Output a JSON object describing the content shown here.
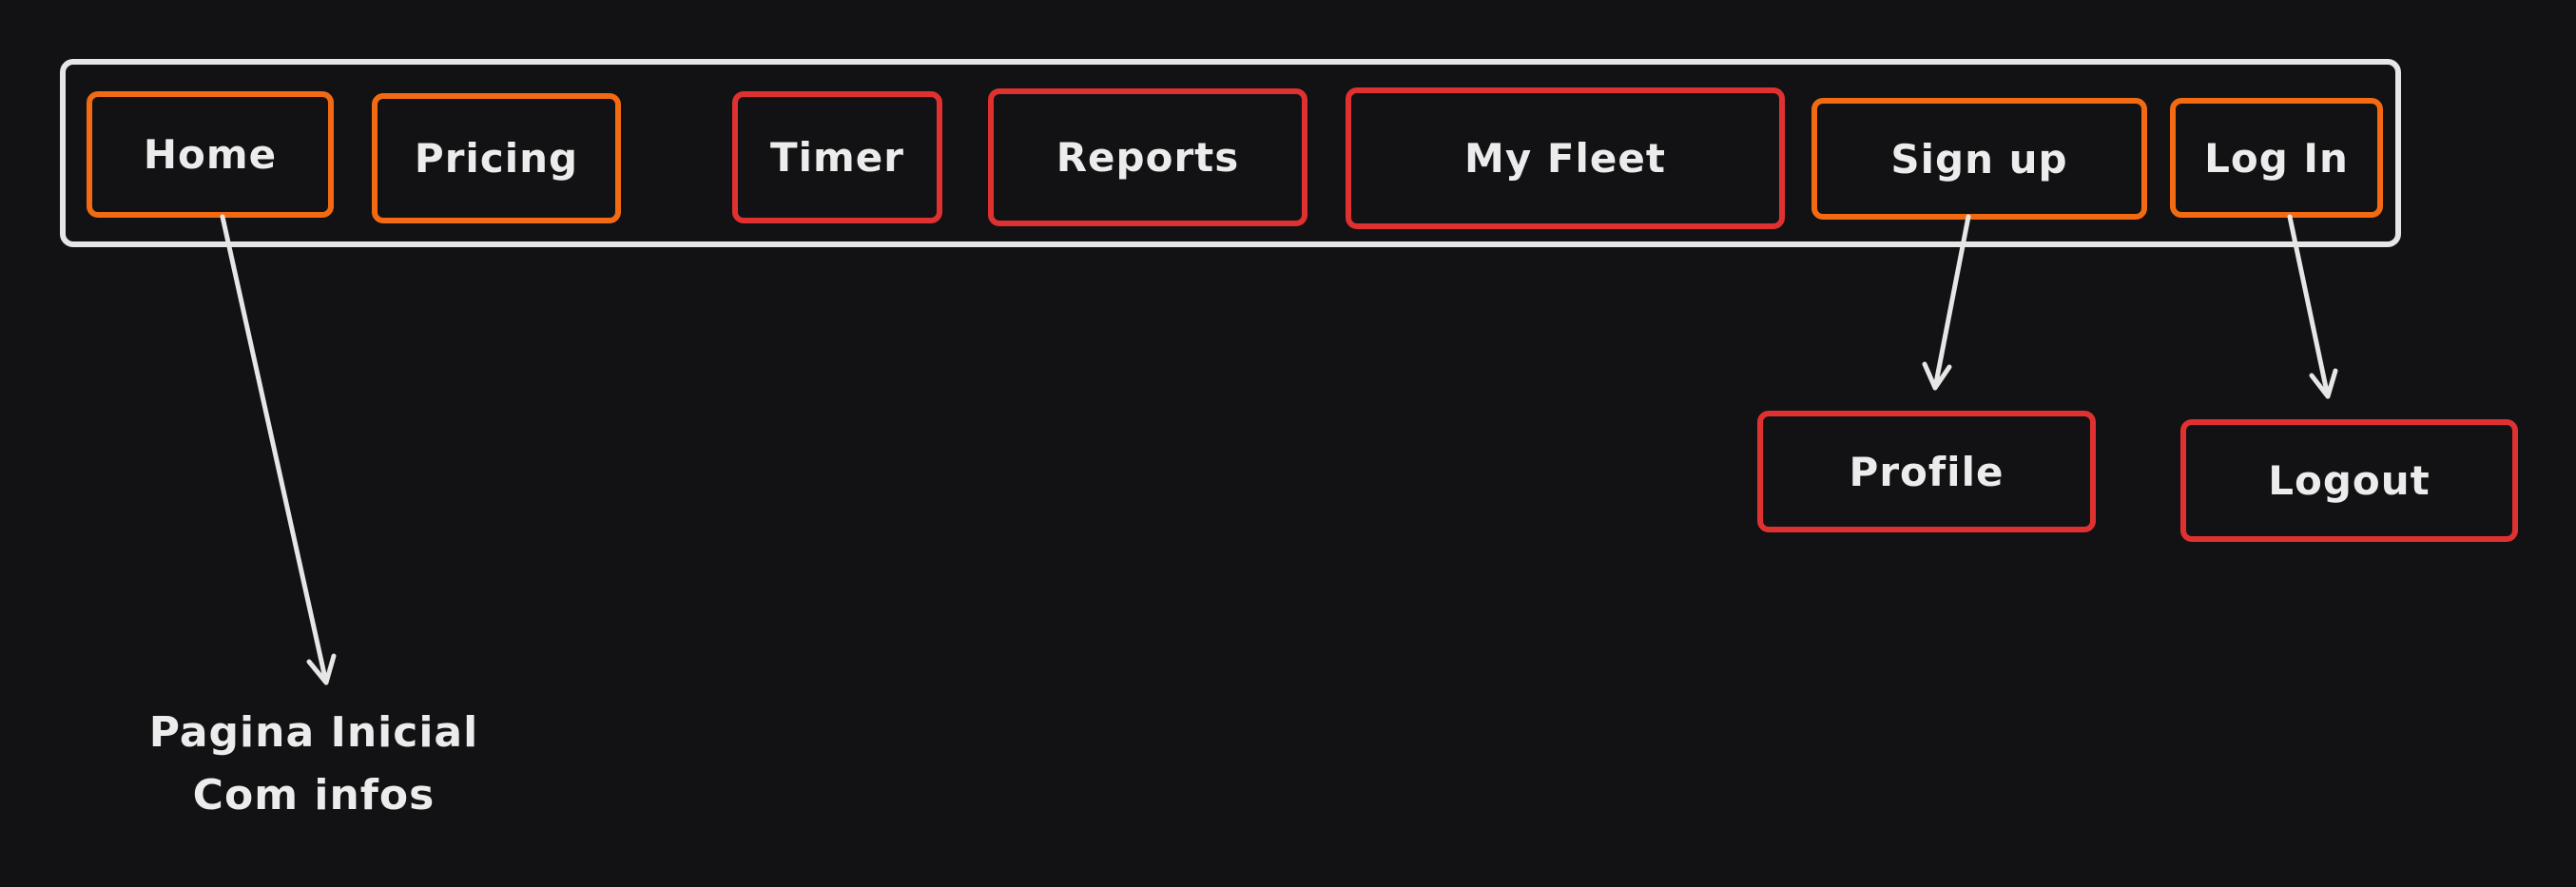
{
  "colors": {
    "background": "#121214",
    "frame": "#e6e6e6",
    "text": "#ececec",
    "orange": "#f26b12",
    "red": "#e03131"
  },
  "nav": {
    "home": "Home",
    "pricing": "Pricing",
    "timer": "Timer",
    "reports": "Reports",
    "my_fleet": "My Fleet",
    "sign_up": "Sign up",
    "log_in": "Log In"
  },
  "targets": {
    "profile": "Profile",
    "logout": "Logout"
  },
  "note": {
    "line1": "Pagina Inicial",
    "line2": "Com infos"
  }
}
